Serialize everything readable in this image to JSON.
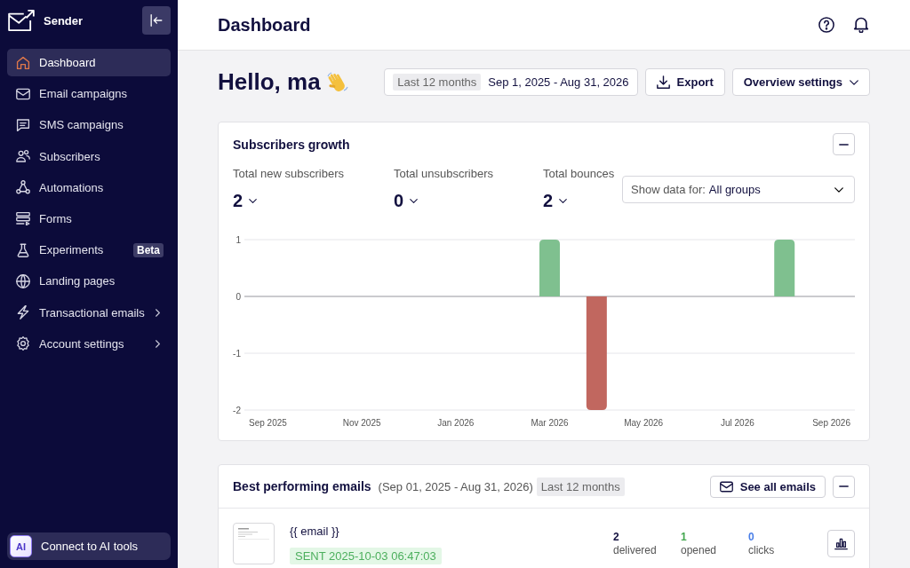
{
  "sidebar": {
    "brand": "Sender",
    "items": [
      {
        "label": "Dashboard",
        "selected": true,
        "submenu": false
      },
      {
        "label": "Email campaigns",
        "selected": false,
        "submenu": false
      },
      {
        "label": "SMS campaigns",
        "selected": false,
        "submenu": false
      },
      {
        "label": "Subscribers",
        "selected": false,
        "submenu": false
      },
      {
        "label": "Automations",
        "selected": false,
        "submenu": false
      },
      {
        "label": "Forms",
        "selected": false,
        "submenu": false
      },
      {
        "label": "Experiments",
        "badge": "Beta",
        "selected": false,
        "submenu": false
      },
      {
        "label": "Landing pages",
        "selected": false,
        "submenu": false
      },
      {
        "label": "Transactional emails",
        "selected": false,
        "submenu": true
      },
      {
        "label": "Account settings",
        "selected": false,
        "submenu": true
      }
    ],
    "footer_button": {
      "icon_text": "AI",
      "label": "Connect to AI tools"
    }
  },
  "header": {
    "title": "Dashboard"
  },
  "greeting": "Hello, ma",
  "toolbar": {
    "date_range": {
      "preset": "Last 12 months",
      "range": "Sep 1, 2025 - Aug 31, 2026"
    },
    "buttons": [
      {
        "kind": "export",
        "label": "Export"
      },
      {
        "kind": "menu",
        "label": "Overview settings"
      }
    ]
  },
  "subscribers_growth": {
    "title": "Subscribers growth",
    "stats": [
      {
        "label": "Total new subscribers",
        "value": "2"
      },
      {
        "label": "Total unsubscribers",
        "value": "0"
      },
      {
        "label": "Total bounces",
        "value": "2"
      }
    ],
    "group_select": {
      "label": "Show data for:",
      "value": "All groups"
    },
    "chart_data": {
      "type": "bar",
      "categories": [
        "Sep 2025",
        null,
        "Nov 2025",
        null,
        "Jan 2026",
        null,
        "Mar 2026",
        null,
        "May 2026",
        null,
        "Jul 2026",
        null,
        "Sep 2026"
      ],
      "ylim": [
        -2,
        1
      ],
      "yticks": [
        1,
        0,
        -1,
        -2
      ],
      "grid": true,
      "series": [
        {
          "color": "#7fc08f",
          "values": [
            0,
            0,
            0,
            0,
            0,
            0,
            1,
            0,
            0,
            0,
            0,
            1,
            0
          ]
        },
        {
          "color": "#c1675f",
          "values": [
            0,
            0,
            0,
            0,
            0,
            0,
            0,
            -2,
            0,
            0,
            0,
            0,
            0
          ]
        }
      ]
    }
  },
  "best_emails": {
    "title": "Best performing emails",
    "period": "(Sep 01, 2025 - Aug 31, 2026)",
    "preset": "Last 12 months",
    "see_all_button": "See all emails",
    "rows": [
      {
        "subject": "{{ email }}",
        "status": "SENT 2025-10-03 06:47:03",
        "stats": [
          {
            "value": "2",
            "label": "delivered",
            "color": "#12103f"
          },
          {
            "value": "1",
            "label": "opened",
            "color": "#43a64f"
          },
          {
            "value": "0",
            "label": "clicks",
            "color": "#4a7fe8"
          }
        ]
      }
    ]
  }
}
